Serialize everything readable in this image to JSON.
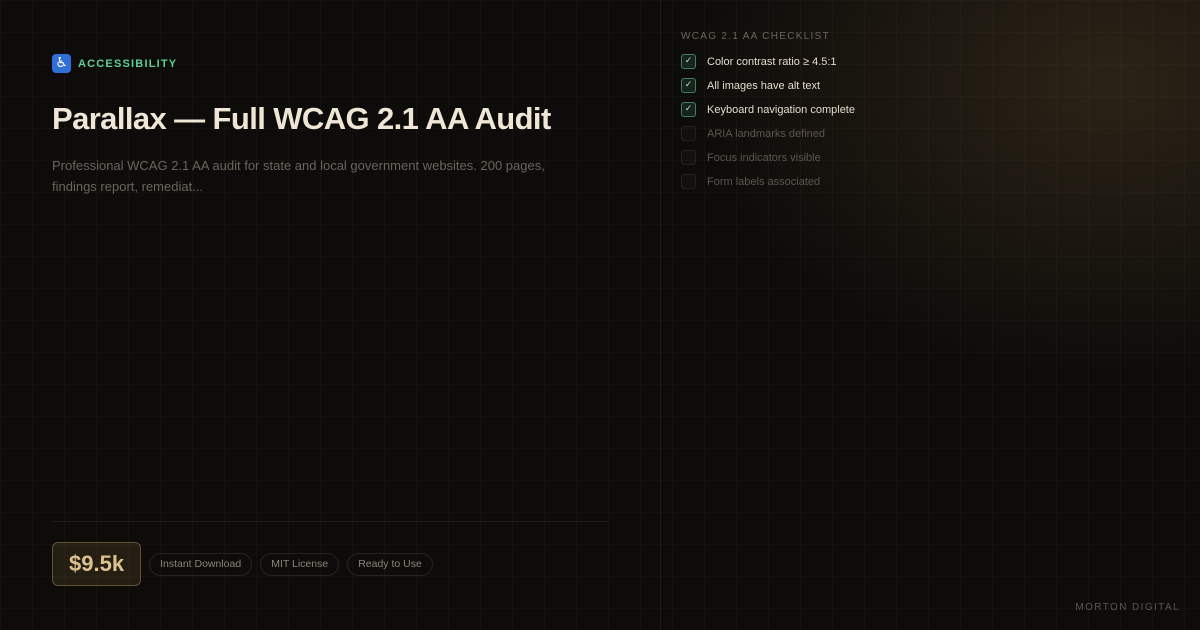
{
  "category": {
    "icon": "wheelchair-icon",
    "label": "ACCESSIBILITY",
    "color": "#5fcf92"
  },
  "product": {
    "title": "Parallax — Full WCAG 2.1 AA Audit",
    "description": "Professional WCAG 2.1 AA audit for state and local government websites. 200 pages, findings report, remediat..."
  },
  "pricing": {
    "price": "$9.5k",
    "tags": [
      "Instant Download",
      "MIT License",
      "Ready to Use"
    ]
  },
  "checklist": {
    "title": "WCAG 2.1 AA CHECKLIST",
    "items": [
      {
        "label": "Color contrast ratio ≥ 4.5:1",
        "checked": true
      },
      {
        "label": "All images have alt text",
        "checked": true
      },
      {
        "label": "Keyboard navigation complete",
        "checked": true
      },
      {
        "label": "ARIA landmarks defined",
        "checked": false
      },
      {
        "label": "Focus indicators visible",
        "checked": false
      },
      {
        "label": "Form labels associated",
        "checked": false
      }
    ]
  },
  "brand": "MORTON DIGITAL",
  "colors": {
    "background": "#0d0c0a",
    "accent_green": "#5fcf92",
    "accent_gold": "#dcc190",
    "title": "#efe6d6"
  }
}
